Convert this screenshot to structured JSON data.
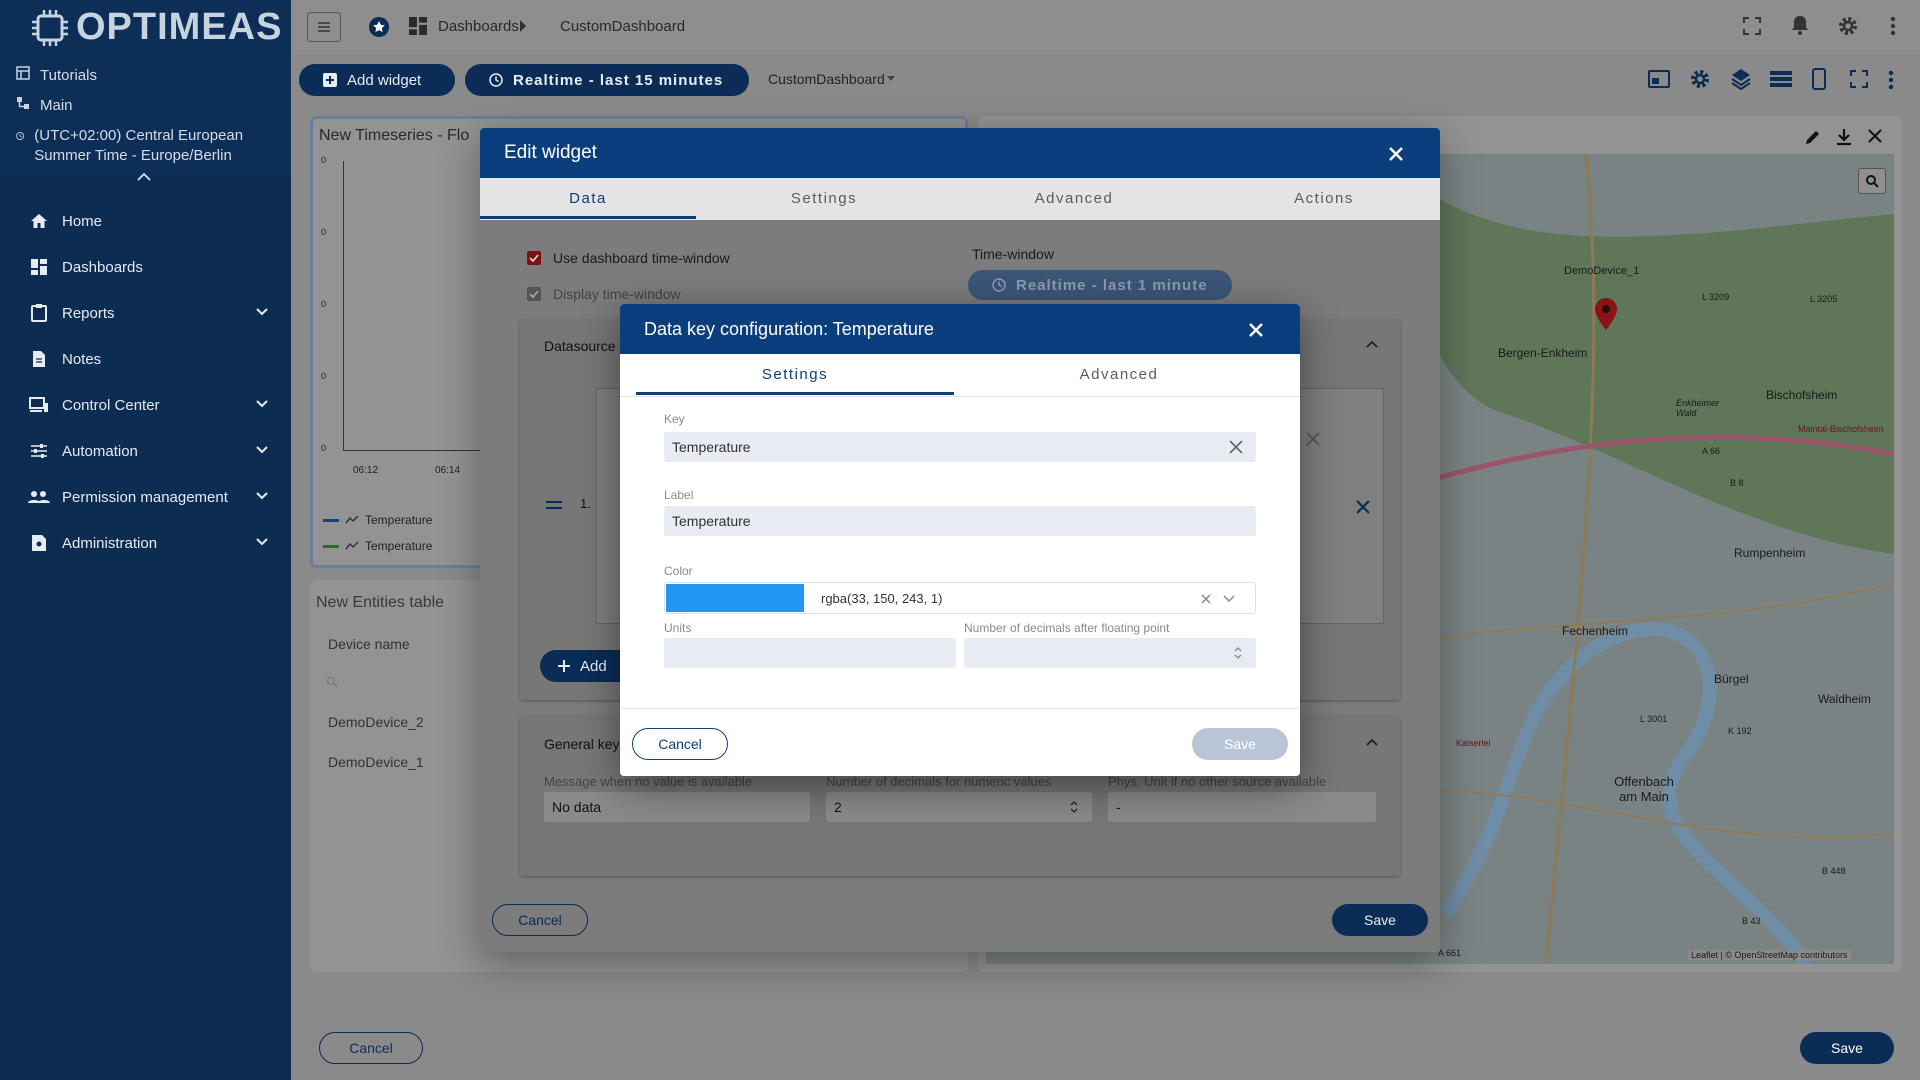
{
  "sidebar": {
    "logo": "OPTIMEAS",
    "tutorials": "Tutorials",
    "main": "Main",
    "timezone": "(UTC+02:00) Central European Summer Time - Europe/Berlin",
    "items": [
      {
        "label": "Home",
        "icon": "home-icon"
      },
      {
        "label": "Dashboards",
        "icon": "dashboards-icon"
      },
      {
        "label": "Reports",
        "icon": "reports-icon",
        "expand": true
      },
      {
        "label": "Notes",
        "icon": "notes-icon"
      },
      {
        "label": "Control Center",
        "icon": "monitor-icon",
        "expand": true
      },
      {
        "label": "Automation",
        "icon": "sliders-icon",
        "expand": true
      },
      {
        "label": "Permission management",
        "icon": "people-icon",
        "expand": true
      },
      {
        "label": "Administration",
        "icon": "admin-icon",
        "expand": true
      }
    ]
  },
  "topbar": {
    "breadcrumb1": "Dashboards",
    "breadcrumb2": "CustomDashboard"
  },
  "toolbar": {
    "add_widget": "Add widget",
    "realtime": "Realtime - last 15 minutes",
    "dashboard_select": "CustomDashboard"
  },
  "timeseries": {
    "title": "New Timeseries - Flo",
    "y_ticks": [
      "0",
      "0",
      "0",
      "0",
      "0"
    ],
    "x_ticks": [
      "06:12",
      "06:14"
    ],
    "legend": [
      "Temperature",
      "Temperature"
    ]
  },
  "entities": {
    "title": "New Entities table",
    "col": "Device name",
    "rows": [
      "DemoDevice_2",
      "DemoDevice_1"
    ]
  },
  "map": {
    "labels": [
      "DemoDevice_1",
      "Bergen-Enkheim",
      "Bischofsheim",
      "Rumpenheim",
      "Fechenheim",
      "Bürgel",
      "Waldheim",
      "Offenbach am Main",
      "Maintal-Bischofsheim",
      "Enkheimer Wald",
      "L 3209",
      "L 3205",
      "A 66",
      "B 8",
      "L 3001",
      "K 192",
      "B 448",
      "B 43",
      "A 661",
      "Kaiserlei"
    ],
    "attribution": "Leaflet | © OpenStreetMap contributors"
  },
  "edit_widget": {
    "title": "Edit widget",
    "tabs": [
      "Data",
      "Settings",
      "Advanced",
      "Actions"
    ],
    "use_dashboard_tw": "Use dashboard time-window",
    "display_tw": "Display time-window",
    "time_window_label": "Time-window",
    "time_window_value": "Realtime - last 1 minute",
    "datasources": "Datasource",
    "general_key": "General key",
    "msg_no_value_label": "Message when no value is available",
    "msg_no_value": "No data",
    "decimals_label": "Number of decimals for numeric values",
    "decimals": "2",
    "phys_unit_label": "Phys. Unit if no other source available",
    "phys_unit": "-",
    "cancel": "Cancel",
    "save": "Save",
    "add_label": "Add",
    "row_number": "1."
  },
  "datakey": {
    "title": "Data key configuration: Temperature",
    "tabs": [
      "Settings",
      "Advanced"
    ],
    "key_label": "Key",
    "key": "Temperature",
    "label_label": "Label",
    "label": "Temperature",
    "color_label": "Color",
    "color_value": "rgba(33, 150, 243, 1)",
    "color_hex": "#2196f3",
    "units_label": "Units",
    "units": "",
    "decimals_label": "Number of decimals after floating point",
    "decimals": "",
    "cancel": "Cancel",
    "save": "Save"
  },
  "footer": {
    "cancel": "Cancel",
    "save": "Save"
  }
}
